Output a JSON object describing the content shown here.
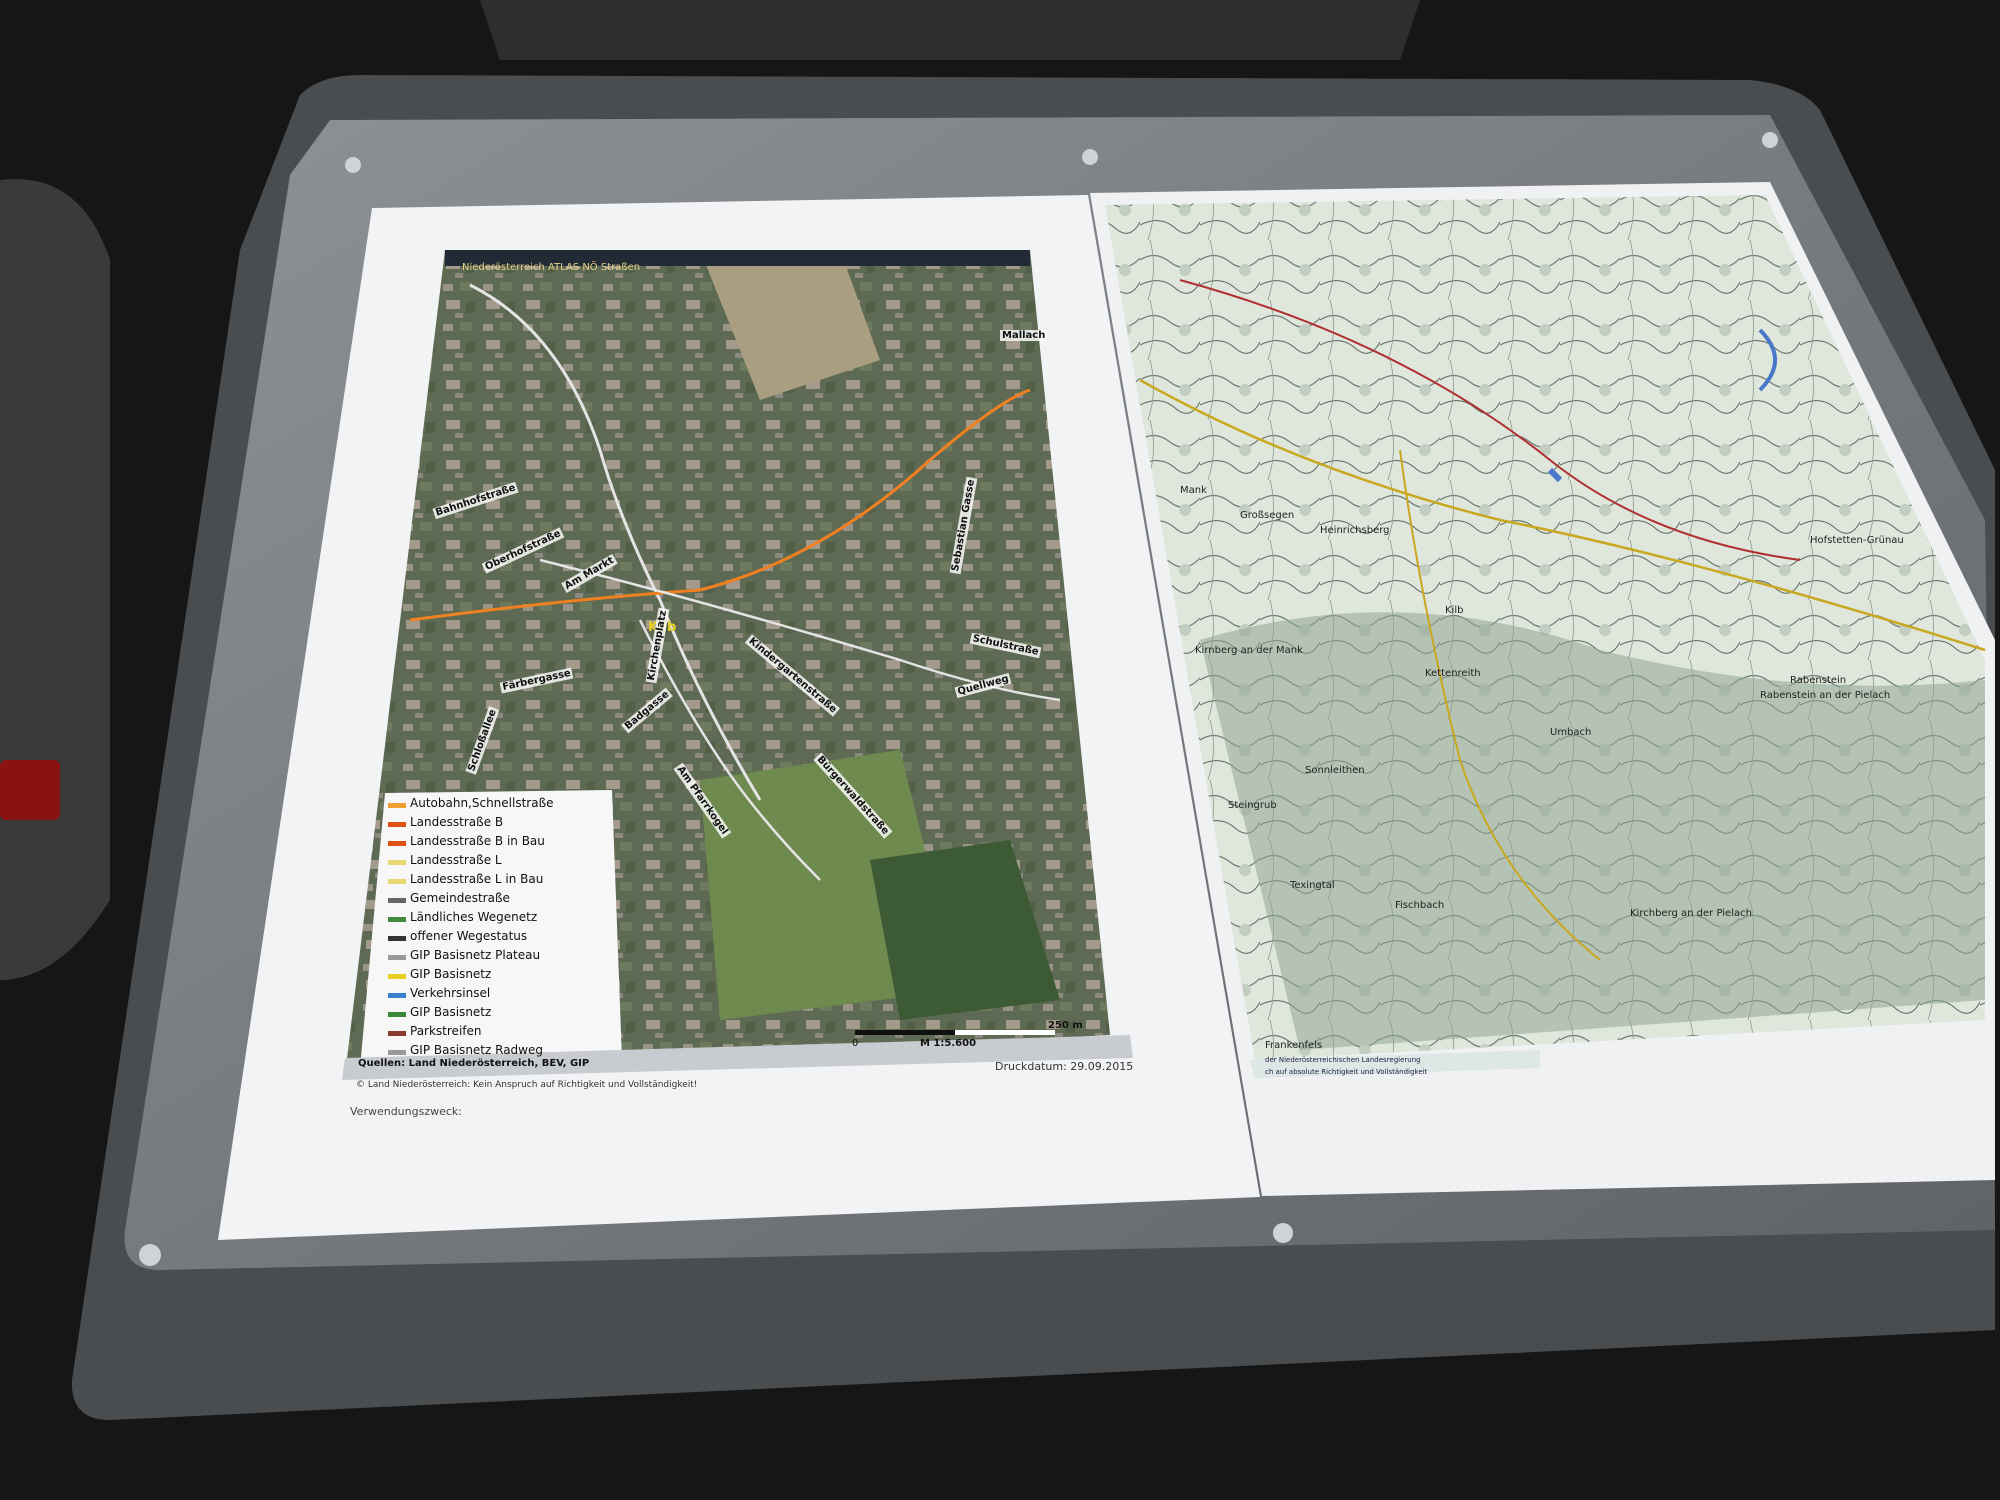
{
  "map_left": {
    "header": "Niederösterreich ATLAS    NÖ Straßen",
    "town_label": "Kilb",
    "streets": [
      "Bahnhofstraße",
      "Oberhofstraße",
      "Am Markt",
      "Kirchenplatz",
      "Färbergasse",
      "Schloßallee",
      "Badgasse",
      "Am Pfarrkogel",
      "Bürgerwaldstraße",
      "Kindergartenstraße",
      "Schulstraße",
      "Quellweg",
      "Mallach",
      "Sebastian Gasse"
    ],
    "legend": [
      "Autobahn,Schnellstraße",
      "Landesstraße B",
      "Landesstraße B in Bau",
      "Landesstraße L",
      "Landesstraße L in Bau",
      "Gemeindestraße",
      "Ländliches Wegenetz",
      "offener Wegestatus",
      "GIP Basisnetz Plateau",
      "GIP Basisnetz",
      "Verkehrsinsel",
      "GIP Basisnetz",
      "Parkstreifen",
      "GIP Basisnetz Radweg"
    ],
    "legend_colors": [
      "#f0a030",
      "#e05010",
      "#e05010",
      "#e8d870",
      "#e8d870",
      "#666666",
      "#3f8a3f",
      "#333333",
      "#999999",
      "#e8d020",
      "#3a80d0",
      "#3a8a3a",
      "#8a3a2a",
      "#999999"
    ],
    "scale_text": "M 1:5.600",
    "scale_zero": "0",
    "scale_end": "250 m",
    "sources": "Quellen: Land Niederösterreich, BEV, GIP",
    "print_date": "Druckdatum: 29.09.2015",
    "copyright": "© Land Niederösterreich: Kein Anspruch auf Richtigkeit und Vollständigkeit!",
    "purpose": "Verwendungszweck:"
  },
  "map_right": {
    "places": [
      "Mank",
      "Kilb",
      "Kettenreith",
      "Umbach",
      "Rabenstein",
      "Rabenstein an der Pielach",
      "Kirnberg an der Mank",
      "Sonnleithen",
      "Steingrub",
      "Texingtal",
      "Fischbach",
      "Kirchberg an der Pielach",
      "Frankenfels",
      "Großsegen",
      "Heinrichsberg",
      "Hofstetten-Grünau"
    ],
    "footer": "der Niederösterreichischen Landesregierung",
    "footer2": "ch auf absolute Richtigkeit und Vollständigkeit"
  }
}
